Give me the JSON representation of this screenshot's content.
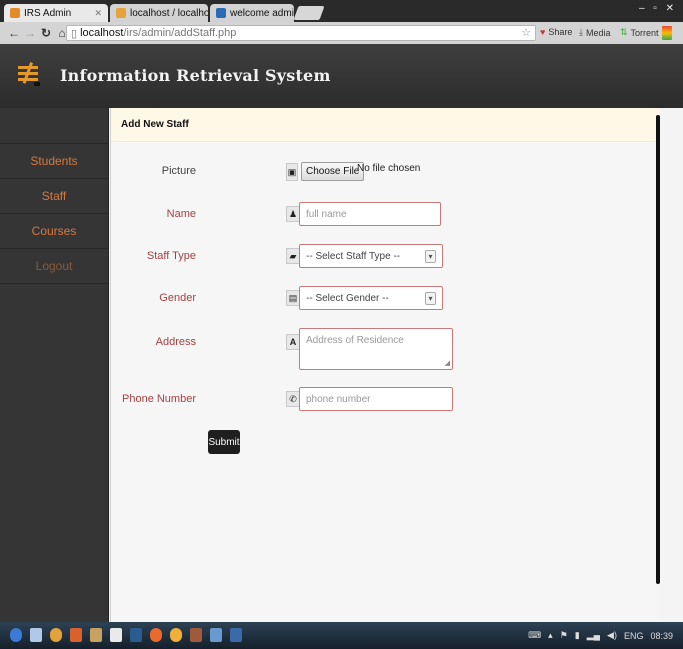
{
  "browser": {
    "tabs": [
      {
        "title": "IRS Admin",
        "color": "#e38b2b"
      },
      {
        "title": "localhost / localhost / e-li",
        "color": "#e8a23c"
      },
      {
        "title": "welcome administrator",
        "color": "#2d6cb5"
      }
    ],
    "address_host": "localhost",
    "address_path": "/irs/admin/addStaff.php",
    "toolbar_items": [
      "Share",
      "Media",
      "Torrent"
    ]
  },
  "app": {
    "brand": "Information Retrieval System",
    "sidebar": {
      "items": [
        {
          "label": "Students"
        },
        {
          "label": "Staff"
        },
        {
          "label": "Courses"
        },
        {
          "label": "Logout"
        }
      ]
    },
    "panel_title": "Add New Staff",
    "form": {
      "picture_label": "Picture",
      "file_button": "Choose File",
      "file_status": "No file chosen",
      "name_label": "Name",
      "name_placeholder": "full name",
      "staff_type_label": "Staff Type",
      "staff_type_value": "-- Select Staff Type --",
      "gender_label": "Gender",
      "gender_value": "-- Select Gender --",
      "address_label": "Address",
      "address_placeholder": "Address of Residence",
      "phone_label": "Phone Number",
      "phone_placeholder": "phone number",
      "submit_label": "Submit"
    }
  },
  "taskbar": {
    "language": "ENG",
    "time": "08:39"
  },
  "colors": {
    "sidebar_text": "#d9783a",
    "field_border": "#c9797a",
    "panel_header": "#fff8e6"
  }
}
